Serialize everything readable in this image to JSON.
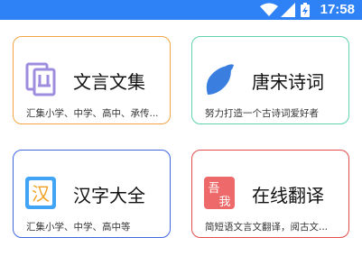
{
  "status_bar": {
    "time": "17:58",
    "icons": [
      "wifi-icon",
      "signal-icon",
      "battery-icon"
    ],
    "background": "#2f82f5"
  },
  "cards": [
    {
      "title": "文言文集",
      "desc": "汇集小学、中学、高中、承传...",
      "icon": "book-icon",
      "border_color": "#f0a646"
    },
    {
      "title": "唐宋诗词",
      "desc": "努力打造一个古诗词爱好者",
      "icon": "leaf-icon",
      "border_color": "#5fd3ae"
    },
    {
      "title": "汉字大全",
      "desc": "汇集小学、中学、高中等",
      "icon": "han-character-icon",
      "icon_text": "汉",
      "border_color": "#3e66e0"
    },
    {
      "title": "在线翻译",
      "desc": "简短语文言文翻译，阅古文...",
      "icon": "translate-stamp-icon",
      "icon_text": [
        "吾",
        "我"
      ],
      "border_color": "#e14b4b"
    }
  ]
}
